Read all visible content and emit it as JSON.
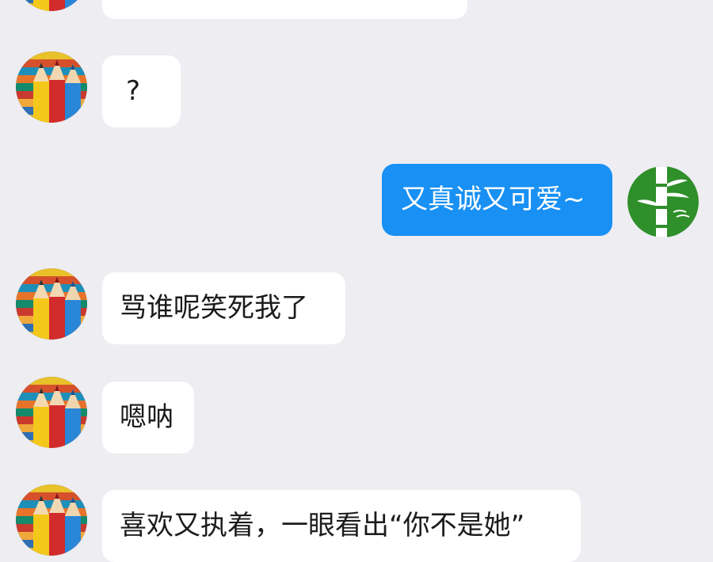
{
  "messages": [
    {
      "side": "in",
      "text": ""
    },
    {
      "side": "in",
      "text": "?"
    },
    {
      "side": "out",
      "text": "又真诚又可爱~"
    },
    {
      "side": "in",
      "text": "骂谁呢笑死我了"
    },
    {
      "side": "in",
      "text": "嗯呐"
    },
    {
      "side": "in",
      "text": "喜欢又执着，一眼看出“你不是她”"
    }
  ],
  "colors": {
    "background": "#ededf2",
    "incoming_bubble": "#ffffff",
    "outgoing_bubble": "#1890f4",
    "outgoing_text": "#ffffff",
    "incoming_text": "#1b1b1b"
  },
  "icons": {
    "contact_avatar": "colored-pencils-avatar",
    "self_avatar": "bamboo-avatar"
  }
}
